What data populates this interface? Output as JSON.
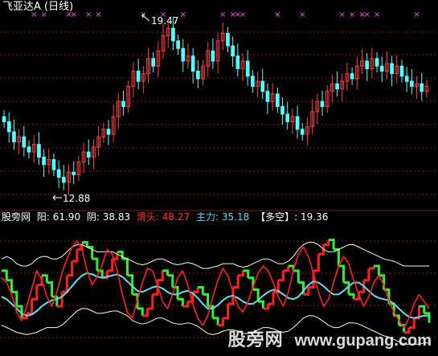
{
  "upper": {
    "title": "飞亚达A (日线)",
    "high_label": "19.47",
    "low_label": "12.88"
  },
  "lower": {
    "indicator_name": "股旁网",
    "items": [
      {
        "key": "阳:",
        "value": "61.90",
        "color": "#ffffff"
      },
      {
        "key": "阴:",
        "value": "38.83",
        "color": "#ffffff"
      },
      {
        "key": "滑头:",
        "value": "48.27",
        "color": "#ff3333"
      },
      {
        "key": "主力:",
        "value": "35.18",
        "color": "#55ddee"
      },
      {
        "key": "【多空】:",
        "value": "19.36",
        "color": "#ffffff"
      }
    ]
  },
  "watermark": {
    "text_cn": "股旁网",
    "text_url": "www.gupang.com"
  },
  "colors": {
    "background": "#000000",
    "grid": "#8b1a1a",
    "up_candle": "#ff4040",
    "down_candle": "#54ffff",
    "marker": "#ff44ff",
    "label_white": "#ffffff",
    "huatou": "#ff2020",
    "zhuli": "#66ddee",
    "band": "#ffffcc",
    "duokong_up": "#ff2020",
    "duokong_down": "#33ee33"
  },
  "chart_data": [
    {
      "type": "candlestick",
      "title": "飞亚达A (日线)",
      "ylim": [
        12.2,
        19.9
      ],
      "annotations": [
        {
          "label": "19.47",
          "type": "high"
        },
        {
          "label": "12.88",
          "type": "low"
        }
      ],
      "close_trend": [
        15.4,
        15.0,
        14.6,
        14.8,
        14.4,
        14.2,
        14.5,
        14.0,
        13.7,
        13.9,
        13.5,
        13.2,
        13.0,
        13.4,
        13.3,
        13.8,
        14.2,
        14.0,
        14.4,
        14.8,
        15.1,
        14.9,
        15.6,
        16.2,
        16.0,
        16.8,
        17.4,
        17.0,
        17.3,
        17.9,
        17.6,
        18.2,
        18.8,
        19.1,
        18.6,
        18.3,
        17.8,
        18.0,
        17.4,
        17.1,
        17.6,
        18.2,
        17.8,
        18.6,
        18.9,
        18.4,
        18.0,
        17.5,
        17.8,
        17.2,
        16.8,
        17.0,
        16.6,
        16.2,
        16.5,
        16.0,
        15.7,
        15.4,
        15.6,
        15.1,
        14.9,
        15.2,
        15.8,
        16.2,
        16.0,
        16.6,
        16.9,
        16.7,
        17.0,
        17.3,
        17.1,
        17.6,
        17.8,
        17.5,
        17.9,
        17.6,
        17.4,
        17.7,
        17.3,
        17.6,
        17.2,
        17.0,
        16.8,
        16.9,
        16.6,
        16.8
      ],
      "marker_days": [
        6,
        8,
        13,
        14,
        17,
        19,
        28,
        32,
        36,
        44,
        46,
        47,
        48,
        55,
        60,
        68,
        70,
        72,
        73,
        75,
        83
      ]
    },
    {
      "type": "line",
      "title": "股旁网",
      "ylim": [
        0,
        110
      ],
      "series": [
        {
          "name": "滑头",
          "values": [
            64,
            60,
            50,
            35,
            28,
            40,
            55,
            70,
            62,
            48,
            40,
            52,
            68,
            80,
            90,
            95,
            88,
            70,
            58,
            65,
            75,
            88,
            84,
            70,
            50,
            35,
            30,
            45,
            60,
            72,
            70,
            58,
            44,
            38,
            50,
            64,
            70,
            58,
            42,
            30,
            24,
            32,
            48,
            62,
            72,
            66,
            52,
            40,
            35,
            44,
            56,
            68,
            74,
            70,
            60,
            48,
            40,
            52,
            70,
            84,
            90,
            82,
            68,
            52,
            40,
            46,
            60,
            74,
            82,
            76,
            62,
            50,
            40,
            48,
            60,
            66,
            58,
            45,
            35,
            28,
            22,
            30,
            42,
            50,
            44,
            38
          ]
        },
        {
          "name": "主力",
          "values": [
            48,
            46,
            42,
            38,
            34,
            32,
            33,
            36,
            40,
            43,
            45,
            46,
            48,
            52,
            57,
            62,
            66,
            68,
            67,
            65,
            64,
            65,
            66,
            67,
            65,
            61,
            57,
            53,
            52,
            54,
            56,
            57,
            55,
            52,
            50,
            50,
            52,
            53,
            51,
            47,
            42,
            38,
            38,
            41,
            45,
            48,
            49,
            47,
            44,
            42,
            42,
            45,
            49,
            52,
            54,
            53,
            50,
            47,
            46,
            48,
            53,
            58,
            61,
            60,
            57,
            53,
            50,
            50,
            53,
            57,
            60,
            60,
            57,
            53,
            49,
            47,
            46,
            45,
            42,
            38,
            34,
            31,
            30,
            31,
            32,
            32
          ]
        },
        {
          "name": "多空",
          "values": [
            70,
            62,
            52,
            40,
            30,
            34,
            46,
            58,
            66,
            60,
            48,
            40,
            52,
            66,
            78,
            88,
            94,
            90,
            80,
            70,
            64,
            70,
            80,
            86,
            80,
            66,
            50,
            38,
            32,
            38,
            50,
            62,
            70,
            66,
            56,
            46,
            40,
            44,
            52,
            56,
            50,
            40,
            30,
            24,
            30,
            42,
            56,
            66,
            70,
            64,
            54,
            44,
            38,
            42,
            52,
            62,
            70,
            74,
            70,
            60,
            50,
            56,
            70,
            84,
            92,
            96,
            88,
            74,
            60,
            50,
            46,
            52,
            62,
            72,
            74,
            66,
            54,
            42,
            32,
            24,
            18,
            22,
            30,
            40,
            34,
            26
          ]
        },
        {
          "name": "阳",
          "values": [
            80,
            82,
            80,
            76,
            74,
            74,
            76,
            80,
            82,
            82,
            80,
            80,
            82,
            86,
            90,
            92,
            92,
            90,
            88,
            86,
            86,
            86,
            86,
            84,
            82,
            80,
            78,
            76,
            75,
            76,
            78,
            80,
            80,
            78,
            76,
            75,
            76,
            77,
            76,
            74,
            72,
            72,
            73,
            74,
            76,
            76,
            76,
            74,
            73,
            74,
            76,
            78,
            80,
            80,
            78,
            76,
            76,
            78,
            82,
            88,
            92,
            94,
            94,
            92,
            88,
            86,
            86,
            88,
            90,
            92,
            92,
            90,
            88,
            86,
            84,
            82,
            80,
            79,
            78,
            76,
            74,
            74,
            74,
            74,
            74,
            74
          ]
        },
        {
          "name": "阴",
          "values": [
            24,
            22,
            20,
            18,
            17,
            16,
            17,
            18,
            20,
            22,
            22,
            22,
            24,
            28,
            32,
            36,
            38,
            38,
            36,
            34,
            34,
            35,
            36,
            36,
            34,
            32,
            28,
            26,
            25,
            26,
            28,
            30,
            30,
            28,
            26,
            25,
            25,
            26,
            25,
            23,
            20,
            17,
            16,
            17,
            19,
            20,
            20,
            19,
            17,
            17,
            18,
            20,
            22,
            22,
            21,
            19,
            18,
            19,
            22,
            26,
            30,
            32,
            32,
            30,
            27,
            24,
            22,
            22,
            24,
            26,
            26,
            25,
            23,
            21,
            19,
            17,
            15,
            14,
            12,
            10,
            8,
            8,
            8,
            8,
            9,
            9
          ]
        }
      ]
    }
  ]
}
